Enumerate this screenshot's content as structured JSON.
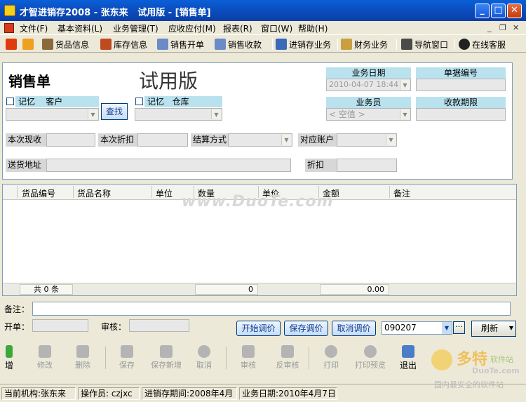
{
  "window": {
    "title": "才智进销存2008 - 张东来   试用版 - [销售单]"
  },
  "menu": [
    "文件(F)",
    "基本资料(L)",
    "业务管理(T)",
    "应收应付(M)",
    "报表(R)",
    "窗口(W)",
    "帮助(H)"
  ],
  "toolbar": [
    "货品信息",
    "库存信息",
    "销售开单",
    "销售收款",
    "进销存业务",
    "财务业务",
    "导航窗口",
    "在线客服"
  ],
  "form": {
    "title": "销售单",
    "watermark": "试用版",
    "remember1": "记忆",
    "customer_label": "客户",
    "search_button": "查找",
    "remember2": "记忆",
    "warehouse_label": "仓库",
    "biz_date_label": "业务日期",
    "biz_date_value": "2010-04-07 18:44",
    "doc_no_label": "单据编号",
    "salesperson_label": "业务员",
    "salesperson_value": "< 空值 >",
    "due_label": "收款期限",
    "cash_label": "本次现收",
    "discount_label": "本次折扣",
    "settle_label": "结算方式",
    "account_label": "对应账户",
    "address_label": "送货地址",
    "rebate_label": "折扣"
  },
  "grid": {
    "columns": [
      "货品编号",
      "货品名称",
      "单位",
      "数量",
      "单价",
      "金额",
      "备注"
    ],
    "watermark": "www.DuoTe.com",
    "footer": {
      "count": "共 0 条",
      "qty_total": "0",
      "amount_total": "0.00"
    }
  },
  "bottom": {
    "remark_label": "备注：",
    "maker_label": "开单：",
    "auditor_label": "审核：",
    "start_price_button": "开始调价",
    "save_price_button": "保存调价",
    "cancel_price_button": "取消调价",
    "code_value": "090207",
    "refresh_button": "刷新"
  },
  "actions": [
    "增",
    "修改",
    "删除",
    "保存",
    "保存新增",
    "取消",
    "审核",
    "反审核",
    "打印",
    "打印预览",
    "退出"
  ],
  "status": {
    "org": "当前机构:张东来",
    "operator": "操作员: czjxc",
    "period": "进销存期间:2008年4月",
    "bizdate": "业务日期:2010年4月7日"
  },
  "logo": {
    "name": "多特",
    "sub": "软件站",
    "url": "DuoTe.com",
    "slogan": "国内最安全的软件站"
  }
}
